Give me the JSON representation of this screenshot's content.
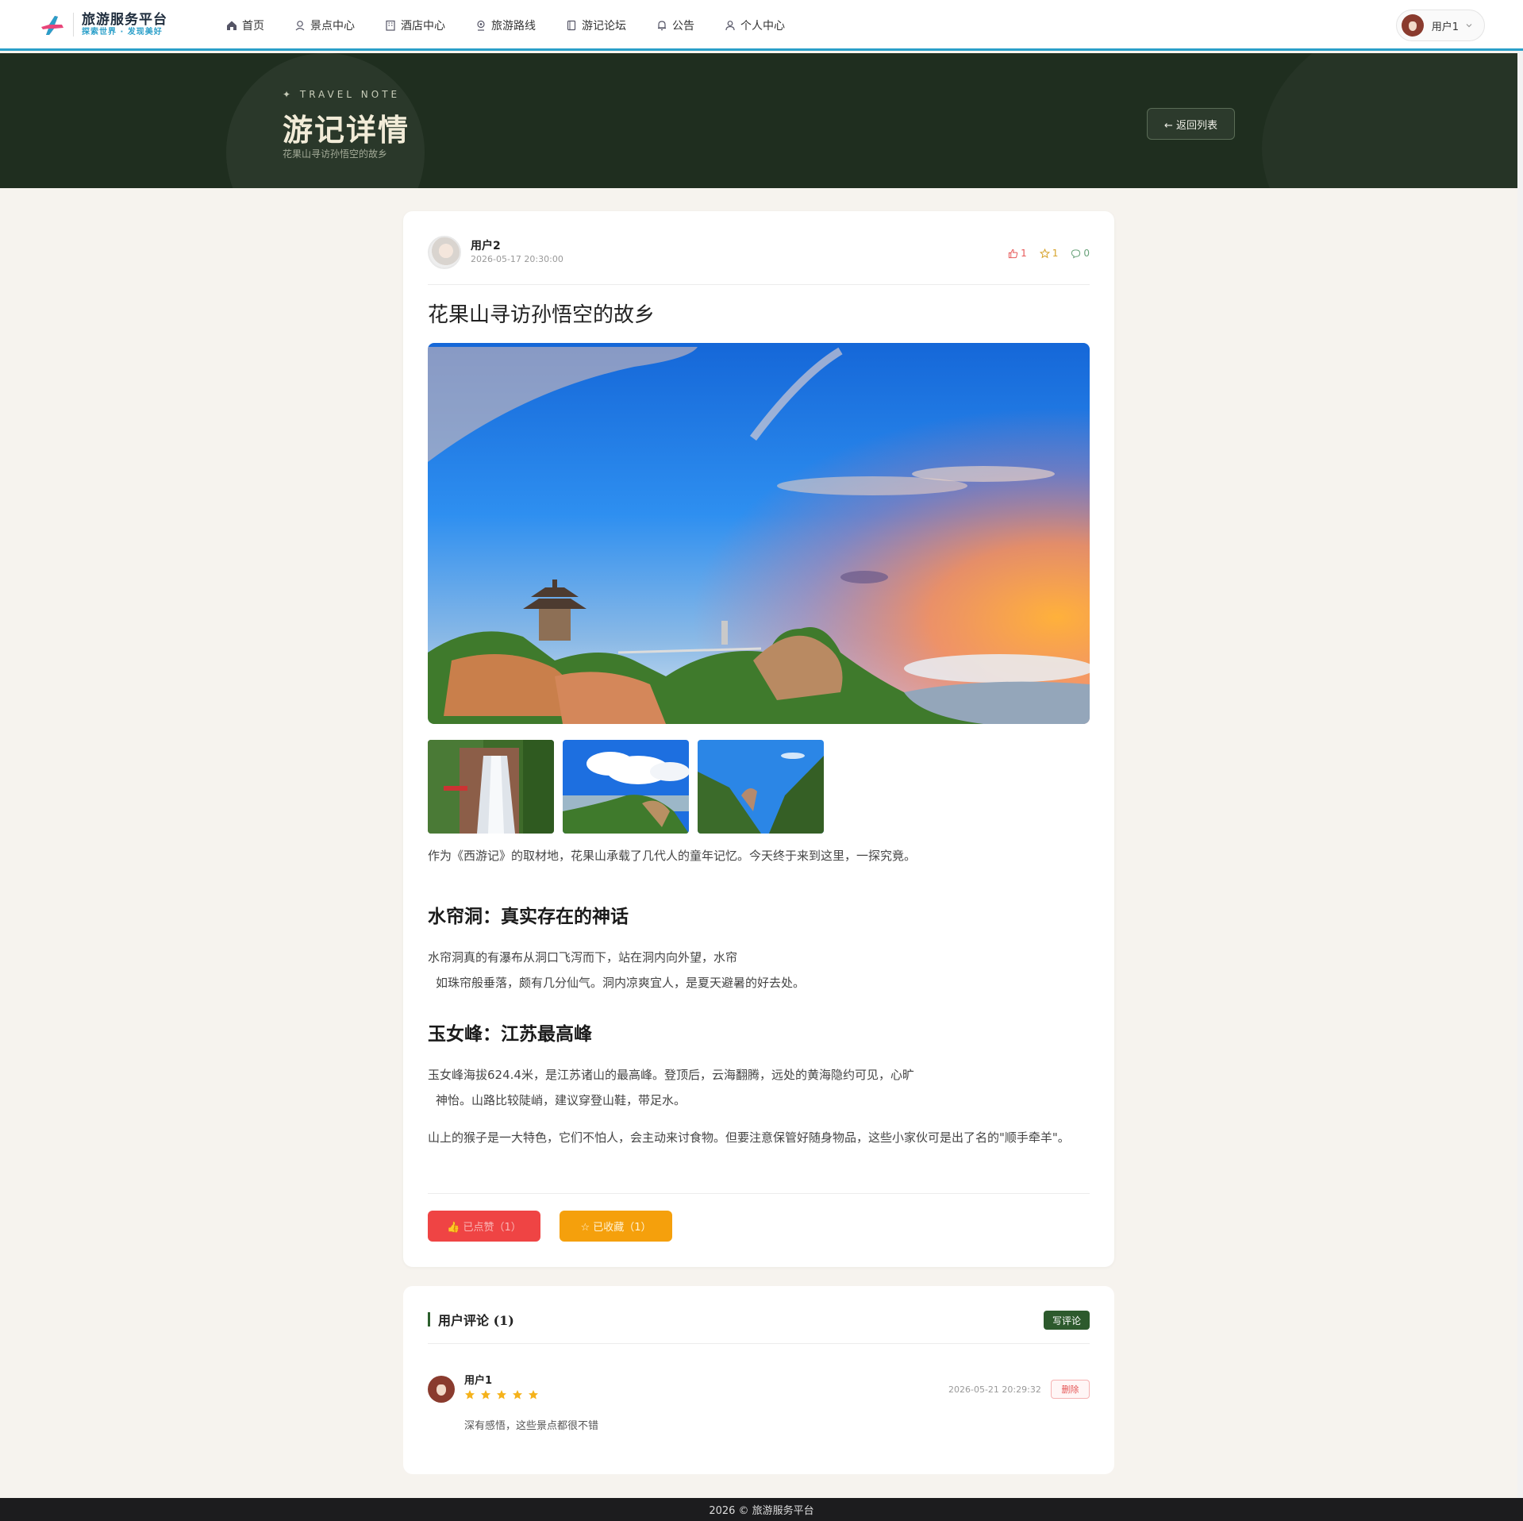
{
  "brand": {
    "title": "旅游服务平台",
    "subtitle": "探索世界 · 发现美好"
  },
  "nav": [
    {
      "label": "首页",
      "icon": "home-icon"
    },
    {
      "label": "景点中心",
      "icon": "pin-icon"
    },
    {
      "label": "酒店中心",
      "icon": "building-icon"
    },
    {
      "label": "旅游路线",
      "icon": "route-icon"
    },
    {
      "label": "游记论坛",
      "icon": "book-icon"
    },
    {
      "label": "公告",
      "icon": "bell-icon"
    },
    {
      "label": "个人中心",
      "icon": "user-icon"
    }
  ],
  "user": {
    "name": "用户1"
  },
  "hero": {
    "kicker": "✦ TRAVEL NOTE",
    "title": "游记详情",
    "subtitle": "花果山寻访孙悟空的故乡",
    "back_label": "← 返回列表"
  },
  "post": {
    "author": "用户2",
    "time": "2026-05-17 20:30:00",
    "likes": "1",
    "favorites": "1",
    "comments": "0",
    "title": "花果山寻访孙悟空的故乡",
    "intro": "作为《西游记》的取材地，花果山承载了几代人的童年记忆。今天终于来到这里，一探究竟。",
    "section1_title": "水帘洞：真实存在的神话",
    "section1_line1": "水帘洞真的有瀑布从洞口飞泻而下，站在洞内向外望，水帘",
    "section1_line2": "如珠帘般垂落，颇有几分仙气。洞内凉爽宜人，是夏天避暑的好去处。",
    "section2_title": "玉女峰：江苏最高峰",
    "section2_line1": "玉女峰海拔624.4米，是江苏诸山的最高峰。登顶后，云海翻腾，远处的黄海隐约可见，心旷",
    "section2_line2": "神怡。山路比较陡峭，建议穿登山鞋，带足水。",
    "closing": "山上的猴子是一大特色，它们不怕人，会主动来讨食物。但要注意保管好随身物品，这些小家伙可是出了名的\"顺手牵羊\"。",
    "like_button": "👍 已点赞（1）",
    "fav_button": "☆ 已收藏（1）"
  },
  "comments_section": {
    "title": "用户评论 (1)",
    "write_label": "写评论",
    "items": [
      {
        "user": "用户1",
        "rating": 5,
        "time": "2026-05-21 20:29:32",
        "text": "深有感悟，这些景点都很不错",
        "delete_label": "删除"
      }
    ]
  },
  "footer": "2026 © 旅游服务平台",
  "colors": {
    "accent": "#2a9fc9",
    "hero_bg": "#1f2e1f",
    "like": "#ef4444",
    "favorite": "#f5a00c",
    "comment_btn": "#2d5a2d"
  }
}
